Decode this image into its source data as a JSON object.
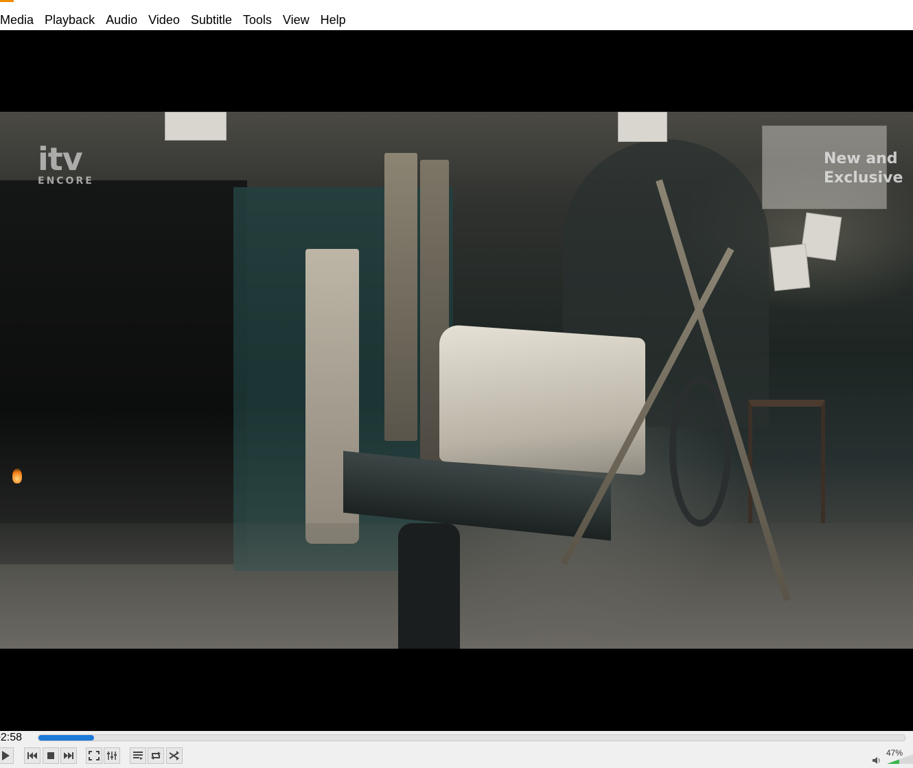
{
  "menu": {
    "items": [
      "Media",
      "Playback",
      "Audio",
      "Video",
      "Subtitle",
      "Tools",
      "View",
      "Help"
    ]
  },
  "video": {
    "channel_logo": "itv",
    "channel_logo_sub": "ENCORE",
    "watermark_line1": "New and",
    "watermark_line2": "Exclusive"
  },
  "controls": {
    "time_elapsed": "02:58",
    "progress_fraction": 0.064,
    "seek_color": "#1c7ad8",
    "volume_label": "47%",
    "volume_fraction": 0.47,
    "buttons": [
      {
        "name": "play-button",
        "icon": "play-icon"
      },
      {
        "name": "previous-button",
        "icon": "previous-icon"
      },
      {
        "name": "stop-button",
        "icon": "stop-icon"
      },
      {
        "name": "next-button",
        "icon": "next-icon"
      },
      {
        "name": "fullscreen-button",
        "icon": "fullscreen-icon"
      },
      {
        "name": "extended-settings-button",
        "icon": "equalizer-icon"
      },
      {
        "name": "playlist-button",
        "icon": "playlist-icon"
      },
      {
        "name": "loop-button",
        "icon": "loop-icon"
      },
      {
        "name": "shuffle-button",
        "icon": "shuffle-icon"
      }
    ]
  }
}
